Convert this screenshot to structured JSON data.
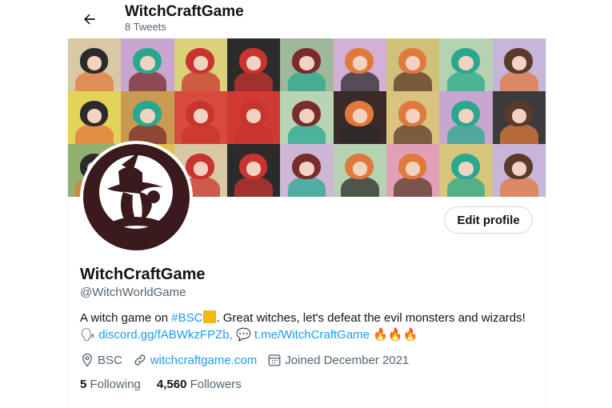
{
  "header": {
    "title": "WitchCraftGame",
    "tweet_count": "8 Tweets"
  },
  "profile": {
    "display_name": "WitchCraftGame",
    "handle": "@WitchWorldGame",
    "edit_label": "Edit profile",
    "bio": {
      "text1": "A witch game on ",
      "hashtag": "#BSC",
      "text2": ". Great witches, let's defeat the evil monsters and wizards!",
      "discord_link": "discord.gg/fABWkzFPZb,",
      "telegram_link": "t.me/WitchCraftGame",
      "fire_emojis": "🔥🔥🔥",
      "speaking_emoji": "🗣",
      "speech_emoji": "💬"
    },
    "location": "BSC",
    "website": "witchcraftgame.com",
    "joined": "Joined December 2021",
    "following_count": "5",
    "following_label": "Following",
    "followers_count": "4,560",
    "followers_label": "Followers"
  },
  "colors": {
    "link": "#1d9bf0",
    "secondary_text": "#536471",
    "avatar_bg": "#3a1a1d"
  }
}
